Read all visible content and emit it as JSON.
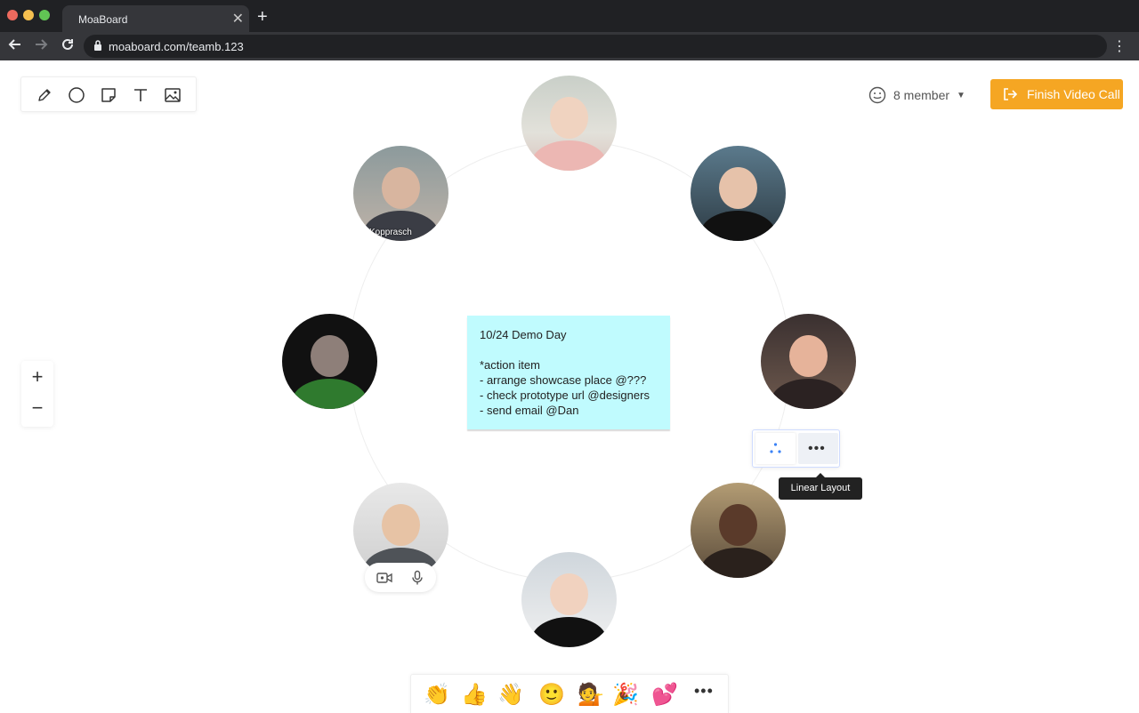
{
  "browser": {
    "tab_title": "MoaBoard",
    "tab_close": "✕",
    "new_tab": "+",
    "url": "moaboard.com/teamb.123",
    "menu": "⋮"
  },
  "toolbar": {
    "tools": [
      "pencil-icon",
      "circle-icon",
      "sticky-note-icon",
      "text-icon",
      "image-icon"
    ]
  },
  "header": {
    "members_label": "8 member",
    "finish_button": "Finish Video Call",
    "accent_color": "#f5a623"
  },
  "zoom": {
    "in_label": "+",
    "out_label": "−"
  },
  "participants": {
    "waving_name_tag": "Kopprasch"
  },
  "note": {
    "color": "#c0fbfe",
    "lines": [
      "10/24 Demo Day",
      "",
      "*action item",
      "- arrange showcase place @???",
      "- check prototype url @designers",
      "- send email @Dan"
    ]
  },
  "layout_popover": {
    "more_label": "•••",
    "tooltip": "Linear Layout"
  },
  "reactions": {
    "items": [
      "👏",
      "👍",
      "👋",
      "🙂",
      "💁",
      "🎉",
      "💕"
    ],
    "more_label": "•••"
  }
}
